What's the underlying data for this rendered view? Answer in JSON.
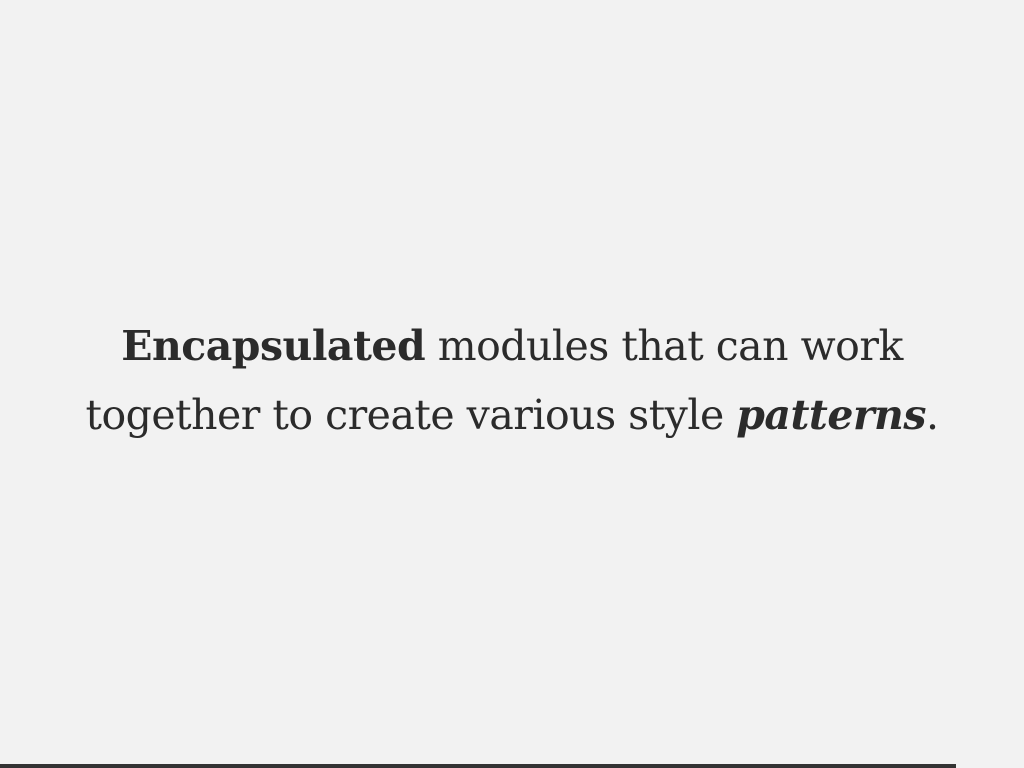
{
  "slide": {
    "text": {
      "bold": "Encapsulated",
      "after_bold": " modules that can work",
      "line2_start": "together to create various style ",
      "italic": "patterns",
      "end": "."
    }
  },
  "progress": {
    "fraction": 0.934,
    "color": "#333333"
  },
  "colors": {
    "background": "#f2f2f2",
    "text": "#2b2b2b"
  }
}
